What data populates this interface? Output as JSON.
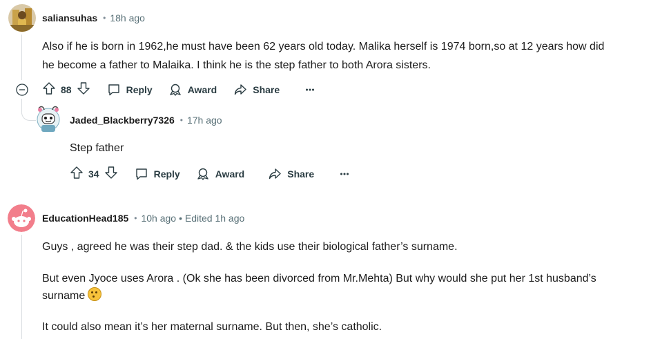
{
  "comments": [
    {
      "author": "saliansuhas",
      "time": "18h ago",
      "lines": [
        "Also if he is born in 1962,he must have been 62 years old today. Malika herself is 1974 born,so at 12 years how did",
        "he become a father to Malaika. I think he is the step father to both Arora sisters."
      ],
      "votes": "88",
      "reply_label": "Reply",
      "award_label": "Award",
      "share_label": "Share"
    },
    {
      "author": "Jaded_Blackberry7326",
      "time": "17h ago",
      "lines": [
        "Step father"
      ],
      "votes": "34",
      "reply_label": "Reply",
      "award_label": "Award",
      "share_label": "Share"
    },
    {
      "author": "EducationHead185",
      "time": "10h ago",
      "edited": "• Edited 1h ago",
      "paragraphs": [
        "Guys , agreed he was their step dad. & the kids use their biological father’s surname.",
        "But even Jyoce uses Arora . (Ok she has been divorced from Mr.Mehta) But why would she put her 1st husband’s",
        "surname",
        "It could also mean it’s her maternal surname. But then, she’s catholic."
      ],
      "emoji": "thinking-face"
    }
  ],
  "icons": {
    "collapse": "collapse-thread-icon",
    "upvote": "upvote-arrow-icon",
    "downvote": "downvote-arrow-icon",
    "reply": "speech-bubble-icon",
    "award": "award-icon",
    "share": "share-arrow-icon",
    "more": "more-options-icon"
  },
  "colors": {
    "text": "#1c1c1c",
    "meta": "#576f76",
    "action": "#2a3c42",
    "thread_line": "#d9dde0",
    "snoo_bg": "#f27e8b"
  }
}
